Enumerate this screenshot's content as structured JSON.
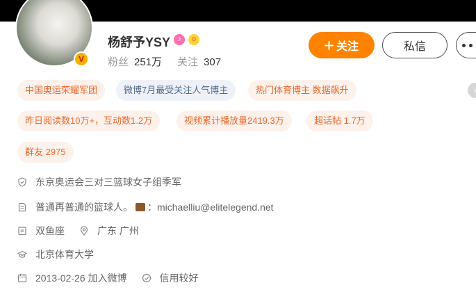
{
  "profile": {
    "name": "杨舒予YSY",
    "fans_label": "粉丝",
    "fans_count": "251万",
    "following_label": "关注",
    "following_count": "307",
    "verify_badge": "V"
  },
  "actions": {
    "follow_label": "关注",
    "message_label": "私信"
  },
  "tags_row1": [
    "中国奥运荣耀军团",
    "微博7月最受关注人气博主",
    "热门体育博主 数据飙升"
  ],
  "tags_row2": [
    "昨日阅读数10万+，互动数1.2万",
    "视频累计播放量2419.3万",
    "超话帖 1.7万"
  ],
  "tags_row3": [
    "群友 2975"
  ],
  "info": {
    "honor": "东京奥运会三对三篮球女子组季军",
    "bio_text": "普通再普通的篮球人。",
    "bio_sep": "：",
    "email": "michaelliu@elitelegend.net",
    "zodiac": "双鱼座",
    "location": "广东 广州",
    "school": "北京体育大学",
    "join_date": "2013-02-26 加入微博",
    "credit": "信用较好"
  },
  "icons": {
    "honor": "shield-icon",
    "bio": "document-icon",
    "briefcase": "briefcase-icon",
    "zodiac": "calendar-card-icon",
    "location": "location-pin-icon",
    "school": "graduation-cap-icon",
    "join": "calendar-icon",
    "credit": "credit-icon"
  },
  "colors": {
    "accent": "#ff8200",
    "tag_orange_text": "#e8692c",
    "tag_orange_bg": "#fdf1eb",
    "tag_blue_text": "#4e6a8d",
    "tag_blue_bg": "#eef2f8",
    "verify": "#f5b000"
  }
}
